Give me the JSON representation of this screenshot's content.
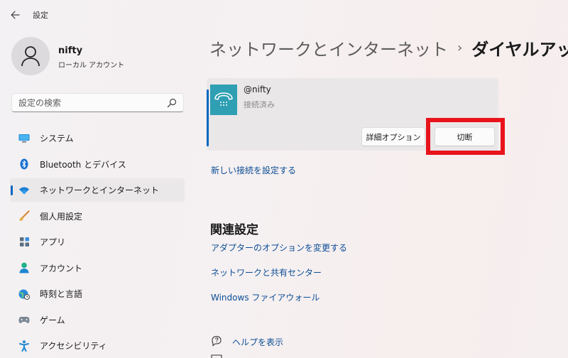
{
  "window": {
    "title": "設定"
  },
  "user": {
    "name": "nifty",
    "account_type": "ローカル アカウント"
  },
  "search": {
    "placeholder": "設定の検索"
  },
  "sidebar": {
    "items": [
      {
        "label": "システム",
        "icon": "monitor-icon"
      },
      {
        "label": "Bluetooth とデバイス",
        "icon": "bluetooth-icon"
      },
      {
        "label": "ネットワークとインターネット",
        "icon": "wifi-icon",
        "active": true
      },
      {
        "label": "個人用設定",
        "icon": "brush-icon"
      },
      {
        "label": "アプリ",
        "icon": "apps-icon"
      },
      {
        "label": "アカウント",
        "icon": "person-icon"
      },
      {
        "label": "時刻と言語",
        "icon": "globe-clock-icon"
      },
      {
        "label": "ゲーム",
        "icon": "gamepad-icon"
      },
      {
        "label": "アクセシビリティ",
        "icon": "accessibility-icon"
      }
    ]
  },
  "breadcrumb": {
    "parent": "ネットワークとインターネット",
    "separator": "›",
    "current": "ダイヤルアップ"
  },
  "connection": {
    "name": "@nifty",
    "status": "接続済み",
    "options_label": "詳細オプション",
    "disconnect_label": "切断"
  },
  "links": {
    "new_connection": "新しい接続を設定する",
    "related_title": "関連設定",
    "adapter_options": "アダプターのオプションを変更する",
    "sharing_center": "ネットワークと共有センター",
    "firewall": "Windows ファイアウォール",
    "help": "ヘルプを表示"
  },
  "colors": {
    "accent": "#0067c0",
    "highlight": "#e8131b",
    "link": "#0a4d96",
    "connection_icon": "#2f9fb3"
  }
}
